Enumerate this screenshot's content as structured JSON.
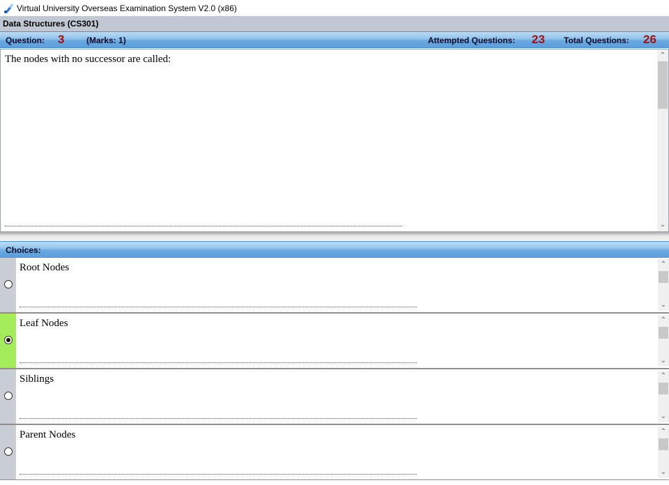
{
  "window": {
    "title": "Virtual University Overseas Examination System  V2.0 (x86)"
  },
  "course": {
    "title": "Data Structures  (CS301)"
  },
  "question_bar": {
    "question_label": "Question:",
    "question_number": "3",
    "marks": "(Marks: 1)",
    "attempted_label": "Attempted Questions:",
    "attempted_count": "23",
    "total_label": "Total Questions:",
    "total_count": "26"
  },
  "question": {
    "text": "The nodes with no successor are called:"
  },
  "choices": {
    "header": "Choices:",
    "items": [
      {
        "label": "Root Nodes",
        "selected": false
      },
      {
        "label": "Leaf Nodes",
        "selected": true
      },
      {
        "label": "Siblings",
        "selected": false
      },
      {
        "label": "Parent Nodes",
        "selected": false
      }
    ]
  },
  "colors": {
    "selected_marker": "#a4ec5c",
    "number_accent": "#a01010",
    "bar_blue": "#6aa9e0"
  },
  "icons": {
    "app": "vu-app-icon",
    "radio": "radio-button",
    "scroll_up": "arrow-up-icon",
    "scroll_down": "arrow-down-icon"
  }
}
